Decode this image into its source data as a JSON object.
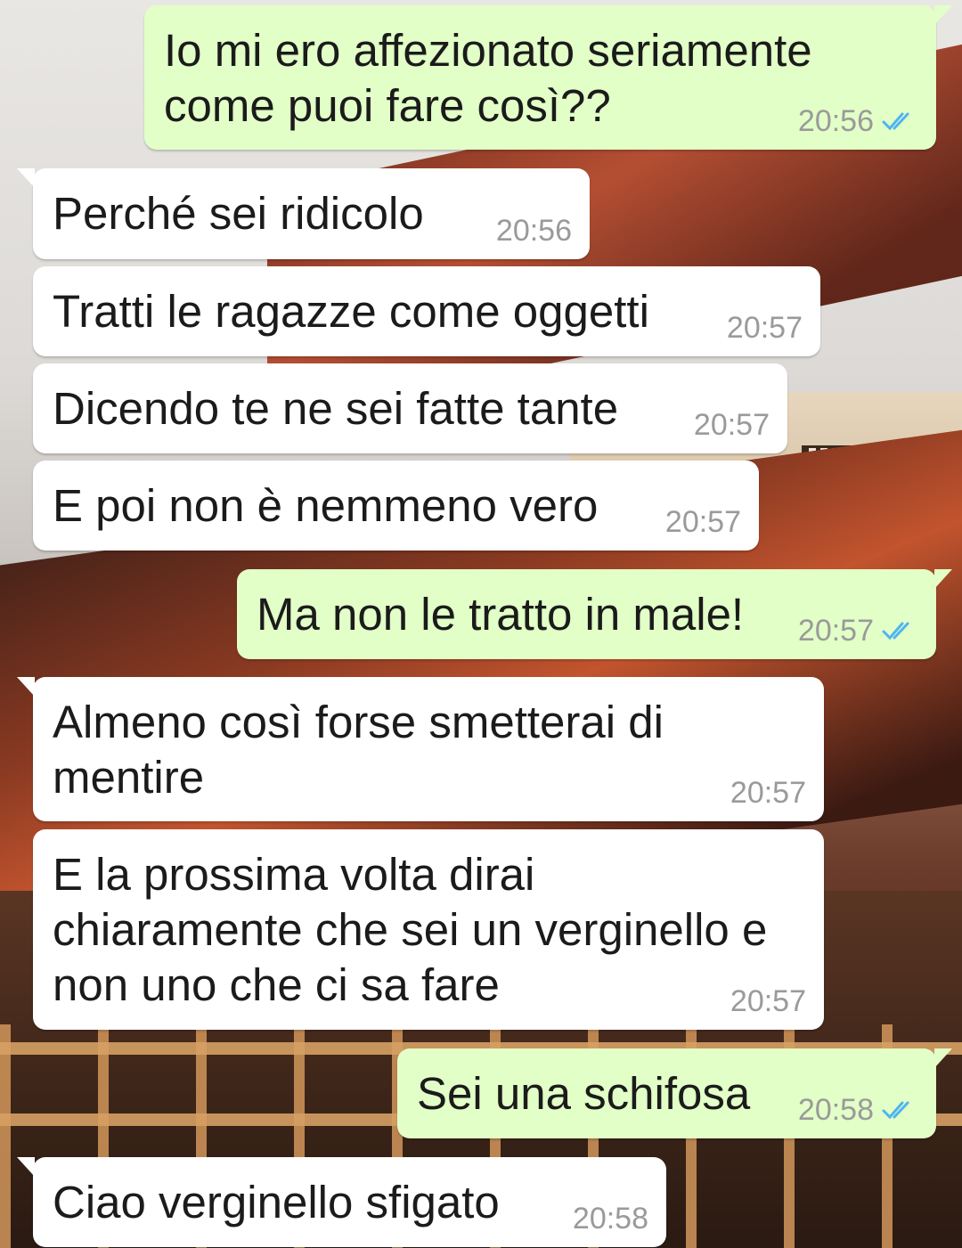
{
  "theme": {
    "incoming_bg": "#ffffff",
    "outgoing_bg": "#e2ffc7",
    "time_color": "#9a9a9a",
    "read_tick_color": "#4fb5f0"
  },
  "messages": [
    {
      "direction": "out",
      "text": "Io mi ero affezionato seriamente\ncome puoi fare così??",
      "time": "20:56",
      "status_icon": "double-check-read-icon"
    },
    {
      "direction": "in",
      "text": "Perché sei ridicolo",
      "time": "20:56"
    },
    {
      "direction": "in",
      "text": "Tratti le ragazze come oggetti",
      "time": "20:57"
    },
    {
      "direction": "in",
      "text": "Dicendo te ne sei fatte tante",
      "time": "20:57"
    },
    {
      "direction": "in",
      "text": "E poi non è nemmeno vero",
      "time": "20:57"
    },
    {
      "direction": "out",
      "text": "Ma non le tratto in male!",
      "time": "20:57",
      "status_icon": "double-check-read-icon"
    },
    {
      "direction": "in",
      "text": "Almeno così forse smetterai di\nmentire",
      "time": "20:57"
    },
    {
      "direction": "in",
      "text": "E la prossima volta dirai\nchiaramente che sei un verginello e\nnon uno che ci sa fare",
      "time": "20:57"
    },
    {
      "direction": "out",
      "text": "Sei una schifosa",
      "time": "20:58",
      "status_icon": "double-check-read-icon"
    },
    {
      "direction": "in",
      "text": "Ciao verginello sfigato",
      "time": "20:58"
    }
  ]
}
